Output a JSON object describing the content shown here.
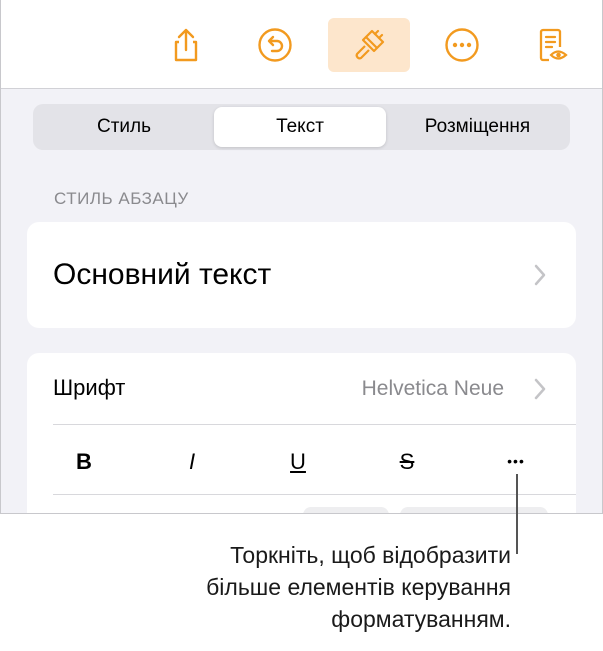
{
  "toolbar": {
    "buttons": [
      {
        "name": "share-icon"
      },
      {
        "name": "undo-icon"
      },
      {
        "name": "format-brush-icon",
        "active": true
      },
      {
        "name": "more-icon"
      },
      {
        "name": "reading-view-icon"
      }
    ],
    "accent": "#f29a1f",
    "active_bg": "#fde6cc"
  },
  "tabs": {
    "items": [
      "Стиль",
      "Текст",
      "Розміщення"
    ],
    "selected": "Текст"
  },
  "paragraph_style": {
    "header": "СТИЛЬ АБЗАЦУ",
    "value": "Основний текст"
  },
  "font": {
    "label": "Шрифт",
    "value": "Helvetica Neue"
  },
  "format_buttons": {
    "bold": "B",
    "italic": "I",
    "underline": "U",
    "strikethrough": "S",
    "more": "•••"
  },
  "callout": {
    "line1": "Торкніть, щоб відобразити",
    "line2": "більше елементів керування",
    "line3": "форматуванням."
  }
}
